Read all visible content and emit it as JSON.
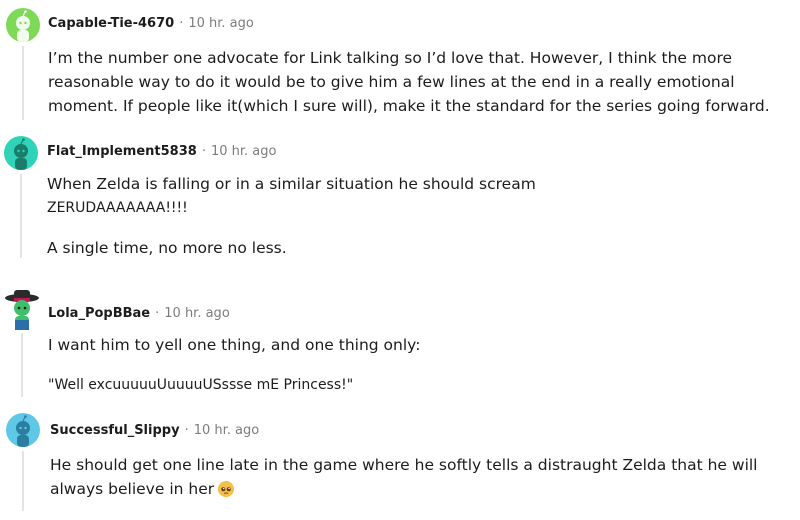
{
  "comments": [
    {
      "username": "Capable-Tie-4670",
      "separator": "·",
      "time": "10 hr. ago",
      "avatar_color": "#7ed957",
      "paragraphs": [
        "I’m the number one advocate for Link talking so I’d love that. However, I think the more reasonable way to do it would be to give him a few lines at the end in a really emotional moment. If people like it(which I sure will), make it the standard for the series going forward."
      ]
    },
    {
      "username": "Flat_Implement5838",
      "separator": "·",
      "time": "10 hr. ago",
      "avatar_color": "#2fd3b8",
      "paragraphs": [
        "When Zelda is falling or in a similar situation he should scream",
        "ZERUDAAAAAAA!!!!",
        "A single time, no more no less."
      ]
    },
    {
      "username": "Lola_PopBBae",
      "separator": "·",
      "time": "10 hr. ago",
      "avatar_color": "#3fbf6a",
      "paragraphs": [
        "I want him to yell one thing, and one thing only:",
        "\"Well excuuuuuUuuuuUSssse mE Princess!\""
      ]
    },
    {
      "username": "Successful_Slippy",
      "separator": "·",
      "time": "10 hr. ago",
      "avatar_color": "#5fc8e6",
      "paragraphs": [
        "He should get one line late in the game where he softly tells a distraught Zelda that he will always believe in her"
      ],
      "emoji": "pleading-face-icon"
    }
  ]
}
